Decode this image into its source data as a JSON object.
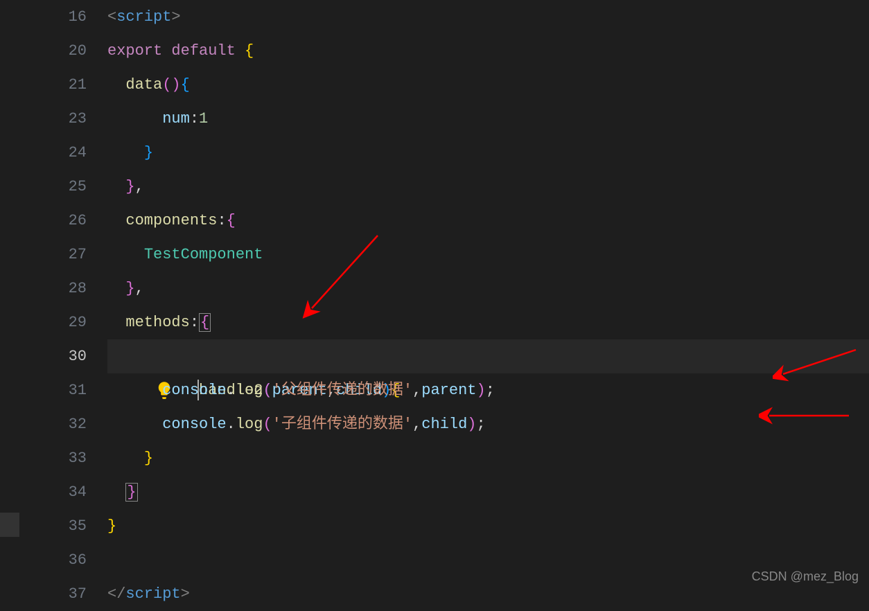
{
  "lines": [
    {
      "num": "16",
      "active": false
    },
    {
      "num": "20",
      "active": false
    },
    {
      "num": "21",
      "active": false
    },
    {
      "num": "23",
      "active": false
    },
    {
      "num": "24",
      "active": false
    },
    {
      "num": "25",
      "active": false
    },
    {
      "num": "26",
      "active": false
    },
    {
      "num": "27",
      "active": false
    },
    {
      "num": "28",
      "active": false
    },
    {
      "num": "29",
      "active": false
    },
    {
      "num": "30",
      "active": true
    },
    {
      "num": "31",
      "active": false
    },
    {
      "num": "32",
      "active": false
    },
    {
      "num": "33",
      "active": false
    },
    {
      "num": "34",
      "active": false
    },
    {
      "num": "35",
      "active": false
    },
    {
      "num": "36",
      "active": false
    },
    {
      "num": "37",
      "active": false
    }
  ],
  "code": {
    "l16": {
      "open": "<",
      "tag": "script",
      "close": ">"
    },
    "l20": {
      "kw1": "export",
      "kw2": "default",
      "brace": "{"
    },
    "l21": {
      "fn": "data",
      "p1": "(",
      "p2": ")",
      "br": "{"
    },
    "l23": {
      "prop": "num",
      "colon": ":",
      "val": "1"
    },
    "l24": {
      "br": "}"
    },
    "l25": {
      "br": "}",
      "comma": ","
    },
    "l26": {
      "prop": "components",
      "colon": ":",
      "br": "{"
    },
    "l27": {
      "cls": "TestComponent"
    },
    "l28": {
      "br": "}",
      "comma": ","
    },
    "l29": {
      "prop": "methods",
      "colon": ":",
      "br": "{"
    },
    "l30": {
      "fn": "handle2",
      "p1": "(",
      "a1": "parent",
      "comma": ",",
      "a2": "child",
      "p2": ")",
      "br": "{"
    },
    "l31": {
      "obj": "console",
      "dot": ".",
      "fn": "log",
      "p1": "(",
      "str": "'父组件传递的数据'",
      "comma": ",",
      "arg": "parent",
      "p2": ")",
      "semi": ";"
    },
    "l32": {
      "obj": "console",
      "dot": ".",
      "fn": "log",
      "p1": "(",
      "str": "'子组件传递的数据'",
      "comma": ",",
      "arg": "child",
      "p2": ")",
      "semi": ";"
    },
    "l33": {
      "br": "}"
    },
    "l34": {
      "br": "}"
    },
    "l35": {
      "br": "}"
    },
    "l36": {
      "text": ""
    },
    "l37": {
      "open": "</",
      "tag": "script",
      "close": ">"
    }
  },
  "watermark": "CSDN @mez_Blog"
}
